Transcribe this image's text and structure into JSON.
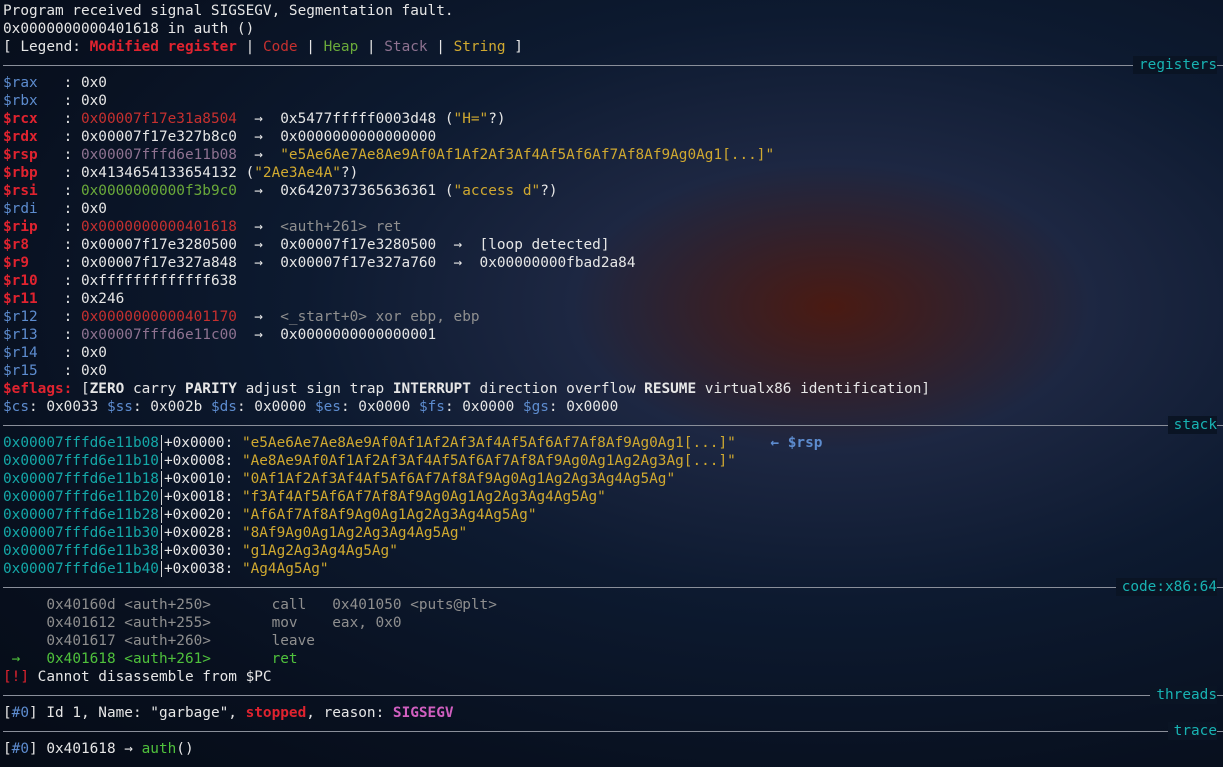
{
  "header": {
    "line1": "Program received signal SIGSEGV, Segmentation fault.",
    "line2": "0x0000000000401618 in auth ()",
    "legend": {
      "open": "[ Legend: ",
      "modified": "Modified register",
      "sep": " | ",
      "code": "Code",
      "heap": "Heap",
      "stack": "Stack",
      "string": "String",
      "close": " ]"
    }
  },
  "sections": {
    "registers": "registers",
    "stack": "stack",
    "code": "code:x86:64",
    "threads": "threads",
    "trace": "trace"
  },
  "registers": {
    "colon": " : ",
    "arrow": "  →  ",
    "rax": {
      "name": "$rax  ",
      "value": "0x0"
    },
    "rbx": {
      "name": "$rbx  ",
      "value": "0x0"
    },
    "rcx": {
      "name": "$rcx  ",
      "value": "0x00007f17e31a8504",
      "deref": "0x5477fffff0003d48 (",
      "str": "\"H=\"",
      "tail": "?)"
    },
    "rdx": {
      "name": "$rdx  ",
      "value": "0x00007f17e327b8c0",
      "deref": "0x0000000000000000"
    },
    "rsp": {
      "name": "$rsp  ",
      "value": "0x00007fffd6e11b08",
      "str": "\"e5Ae6Ae7Ae8Ae9Af0Af1Af2Af3Af4Af5Af6Af7Af8Af9Ag0Ag1[...]\""
    },
    "rbp": {
      "name": "$rbp  ",
      "value": "0x4134654133654132 (",
      "str": "\"2Ae3Ae4A\"",
      "tail": "?)"
    },
    "rsi": {
      "name": "$rsi  ",
      "value": "0x0000000000f3b9c0",
      "deref": "0x6420737365636361 (",
      "str": "\"access d\"",
      "tail": "?)"
    },
    "rdi": {
      "name": "$rdi  ",
      "value": "0x0"
    },
    "rip": {
      "name": "$rip  ",
      "value": "0x0000000000401618",
      "code": "<auth+261> ret"
    },
    "r8": {
      "name": "$r8   ",
      "value": "0x00007f17e3280500",
      "deref": "0x00007f17e3280500",
      "tail": "[loop detected]"
    },
    "r9": {
      "name": "$r9   ",
      "value": "0x00007f17e327a848",
      "deref": "0x00007f17e327a760",
      "tail": "0x00000000fbad2a84"
    },
    "r10": {
      "name": "$r10  ",
      "value": "0xfffffffffffff638"
    },
    "r11": {
      "name": "$r11  ",
      "value": "0x246"
    },
    "r12": {
      "name": "$r12  ",
      "value": "0x0000000000401170",
      "code": "<_start+0> xor ebp, ebp"
    },
    "r13": {
      "name": "$r13  ",
      "value": "0x00007fffd6e11c00",
      "deref": "0x0000000000000001"
    },
    "r14": {
      "name": "$r14  ",
      "value": "0x0"
    },
    "r15": {
      "name": "$r15  ",
      "value": "0x0"
    },
    "eflags": {
      "name": "$eflags:",
      "open": " [",
      "zero": "ZERO",
      "carry": " carry ",
      "parity": "PARITY",
      "mid1": " adjust sign trap ",
      "interrupt": "INTERRUPT",
      "mid2": " direction overflow ",
      "resume": "RESUME",
      "end": " virtualx86 identification]"
    },
    "segments": [
      {
        "name": "$cs",
        "value": ": 0x0033 "
      },
      {
        "name": "$ss",
        "value": ": 0x002b "
      },
      {
        "name": "$ds",
        "value": ": 0x0000 "
      },
      {
        "name": "$es",
        "value": ": 0x0000 "
      },
      {
        "name": "$fs",
        "value": ": 0x0000 "
      },
      {
        "name": "$gs",
        "value": ": 0x0000"
      }
    ]
  },
  "stack": [
    {
      "addr": "0x00007fffd6e11b08",
      "off": "+0x0000: ",
      "str": "\"e5Ae6Ae7Ae8Ae9Af0Af1Af2Af3Af4Af5Af6Af7Af8Af9Ag0Ag1[...]\"",
      "note": "    ← $rsp"
    },
    {
      "addr": "0x00007fffd6e11b10",
      "off": "+0x0008: ",
      "str": "\"Ae8Ae9Af0Af1Af2Af3Af4Af5Af6Af7Af8Af9Ag0Ag1Ag2Ag3Ag[...]\"",
      "note": ""
    },
    {
      "addr": "0x00007fffd6e11b18",
      "off": "+0x0010: ",
      "str": "\"0Af1Af2Af3Af4Af5Af6Af7Af8Af9Ag0Ag1Ag2Ag3Ag4Ag5Ag\"",
      "note": ""
    },
    {
      "addr": "0x00007fffd6e11b20",
      "off": "+0x0018: ",
      "str": "\"f3Af4Af5Af6Af7Af8Af9Ag0Ag1Ag2Ag3Ag4Ag5Ag\"",
      "note": ""
    },
    {
      "addr": "0x00007fffd6e11b28",
      "off": "+0x0020: ",
      "str": "\"Af6Af7Af8Af9Ag0Ag1Ag2Ag3Ag4Ag5Ag\"",
      "note": ""
    },
    {
      "addr": "0x00007fffd6e11b30",
      "off": "+0x0028: ",
      "str": "\"8Af9Ag0Ag1Ag2Ag3Ag4Ag5Ag\"",
      "note": ""
    },
    {
      "addr": "0x00007fffd6e11b38",
      "off": "+0x0030: ",
      "str": "\"g1Ag2Ag3Ag4Ag5Ag\"",
      "note": ""
    },
    {
      "addr": "0x00007fffd6e11b40",
      "off": "+0x0038: ",
      "str": "\"Ag4Ag5Ag\"",
      "note": ""
    }
  ],
  "code": [
    {
      "marker": "     ",
      "addr": "0x40160d",
      "sym": " <auth+250>       ",
      "insn": "call   0x401050 <puts@plt>"
    },
    {
      "marker": "     ",
      "addr": "0x401612",
      "sym": " <auth+255>       ",
      "insn": "mov    eax, 0x0"
    },
    {
      "marker": "     ",
      "addr": "0x401617",
      "sym": " <auth+260>       ",
      "insn": "leave"
    },
    {
      "marker": " →   ",
      "addr": "0x401618",
      "sym": " <auth+261>       ",
      "insn": "ret"
    }
  ],
  "code_error": {
    "tag": "[!]",
    "msg": " Cannot disassemble from $PC"
  },
  "threads": {
    "open": "[",
    "idx": "#0",
    "close": "] ",
    "desc": "Id 1, Name: \"garbage\", ",
    "state": "stopped",
    "mid": ", reason: ",
    "reason": "SIGSEGV"
  },
  "trace": {
    "open": "[",
    "idx": "#0",
    "close": "] ",
    "addr": "0x401618 → ",
    "fn": "auth",
    "tail": "()"
  },
  "colors": {
    "background": "#0a1424",
    "modified": "#e0232f",
    "code": "#c6302f",
    "heap": "#6aaa3a",
    "stack": "#8e7290",
    "string": "#d0a930",
    "section_title": "#18b3b3"
  }
}
